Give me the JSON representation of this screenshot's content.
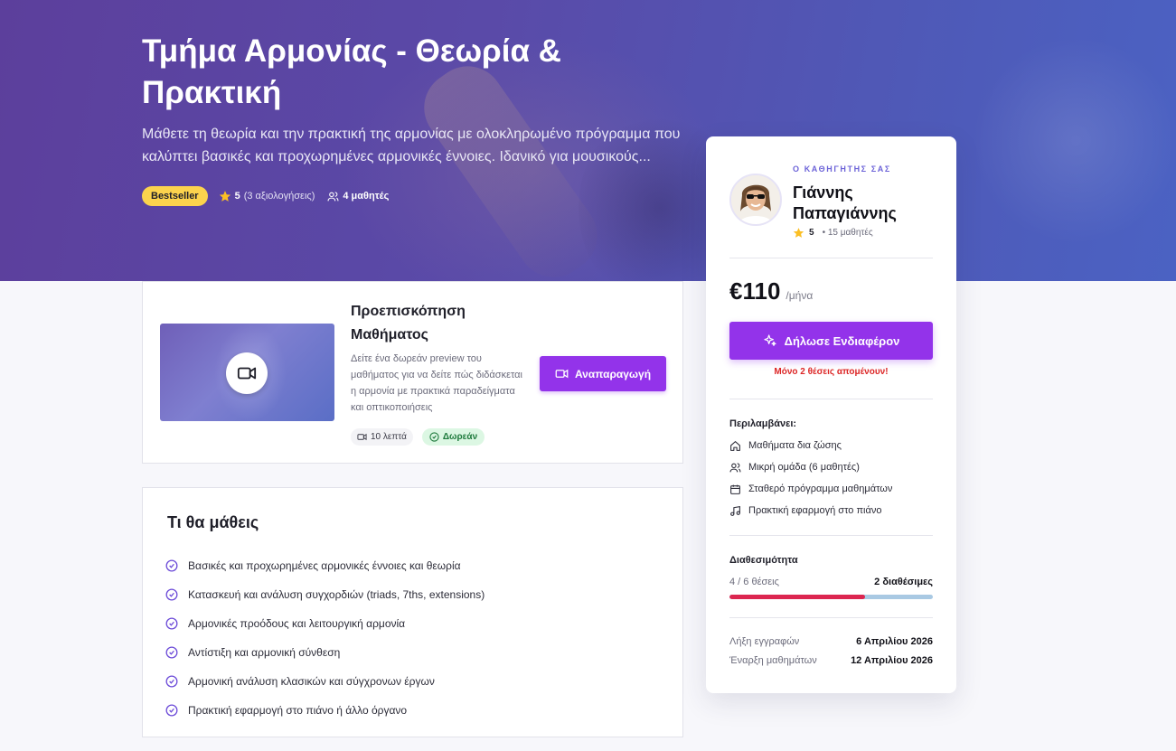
{
  "hero": {
    "title": "Τμήμα Αρμονίας - Θεωρία & Πρακτική",
    "description": "Μάθετε τη θεωρία και την πρακτική της αρμονίας με ολοκληρωμένο πρόγραμμα που καλύπτει βασικές και προχωρημένες αρμονικές έννοιες. Ιδανικό για μουσικούς...",
    "badge": "Bestseller",
    "rating": "5",
    "rating_count": "(3 αξιολογήσεις)",
    "students": "4 μαθητές"
  },
  "preview": {
    "title": "Προεπισκόπηση Μαθήματος",
    "description": "Δείτε ένα δωρεάν preview του μαθήματος για να δείτε πώς διδάσκεται η αρμονία με πρακτικά παραδείγματα και οπτικοποιήσεις",
    "duration": "10 λεπτά",
    "free_label": "Δωρεάν",
    "play_label": "Αναπαραγωγή"
  },
  "learn": {
    "title": "Τι θα μάθεις",
    "items": [
      "Βασικές και προχωρημένες αρμονικές έννοιες και θεωρία",
      "Κατασκευή και ανάλυση συγχορδιών (triads, 7ths, extensions)",
      "Αρμονικές προόδους και λειτουργική αρμονία",
      "Αντίστιξη και αρμονική σύνθεση",
      "Αρμονική ανάλυση κλασικών και σύγχρονων έργων",
      "Πρακτική εφαρμογή στο πιάνο ή άλλο όργανο"
    ]
  },
  "sidebar": {
    "label": "Ο ΚΑΘΗΓΗΤΗΣ ΣΑΣ",
    "teacher_name": "Γιάννης Παπαγιάννης",
    "teacher_rating": "5",
    "teacher_students": "• 15 μαθητές",
    "price": "€110",
    "price_unit": "/μήνα",
    "interest_label": "Δήλωσε Ενδιαφέρον",
    "seats_warning": "Μόνο 2 θέσεις απομένουν!",
    "includes_title": "Περιλαμβάνει:",
    "includes": [
      {
        "icon": "home-icon",
        "label": "Μαθήματα δια ζώσης"
      },
      {
        "icon": "users-icon",
        "label": "Μικρή ομάδα (6 μαθητές)"
      },
      {
        "icon": "calendar-icon",
        "label": "Σταθερό πρόγραμμα μαθημάτων"
      },
      {
        "icon": "music-note-icon",
        "label": "Πρακτική εφαρμογή στο πιάνο"
      }
    ],
    "availability_title": "Διαθεσιμότητα",
    "availability_taken": "4 / 6 θέσεις",
    "availability_free": "2 διαθέσιμες",
    "availability_fraction": 0.667,
    "dates": [
      {
        "label": "Λήξη εγγραφών",
        "value": "6 Απριλίου 2026"
      },
      {
        "label": "Έναρξη μαθημάτων",
        "value": "12 Απριλίου 2026"
      }
    ]
  },
  "colors": {
    "accent": "#9333ea",
    "badge": "#fcd34d",
    "warning": "#dc2626",
    "bar_fill": "#dc2650",
    "bar_track": "#a9c9e3"
  }
}
